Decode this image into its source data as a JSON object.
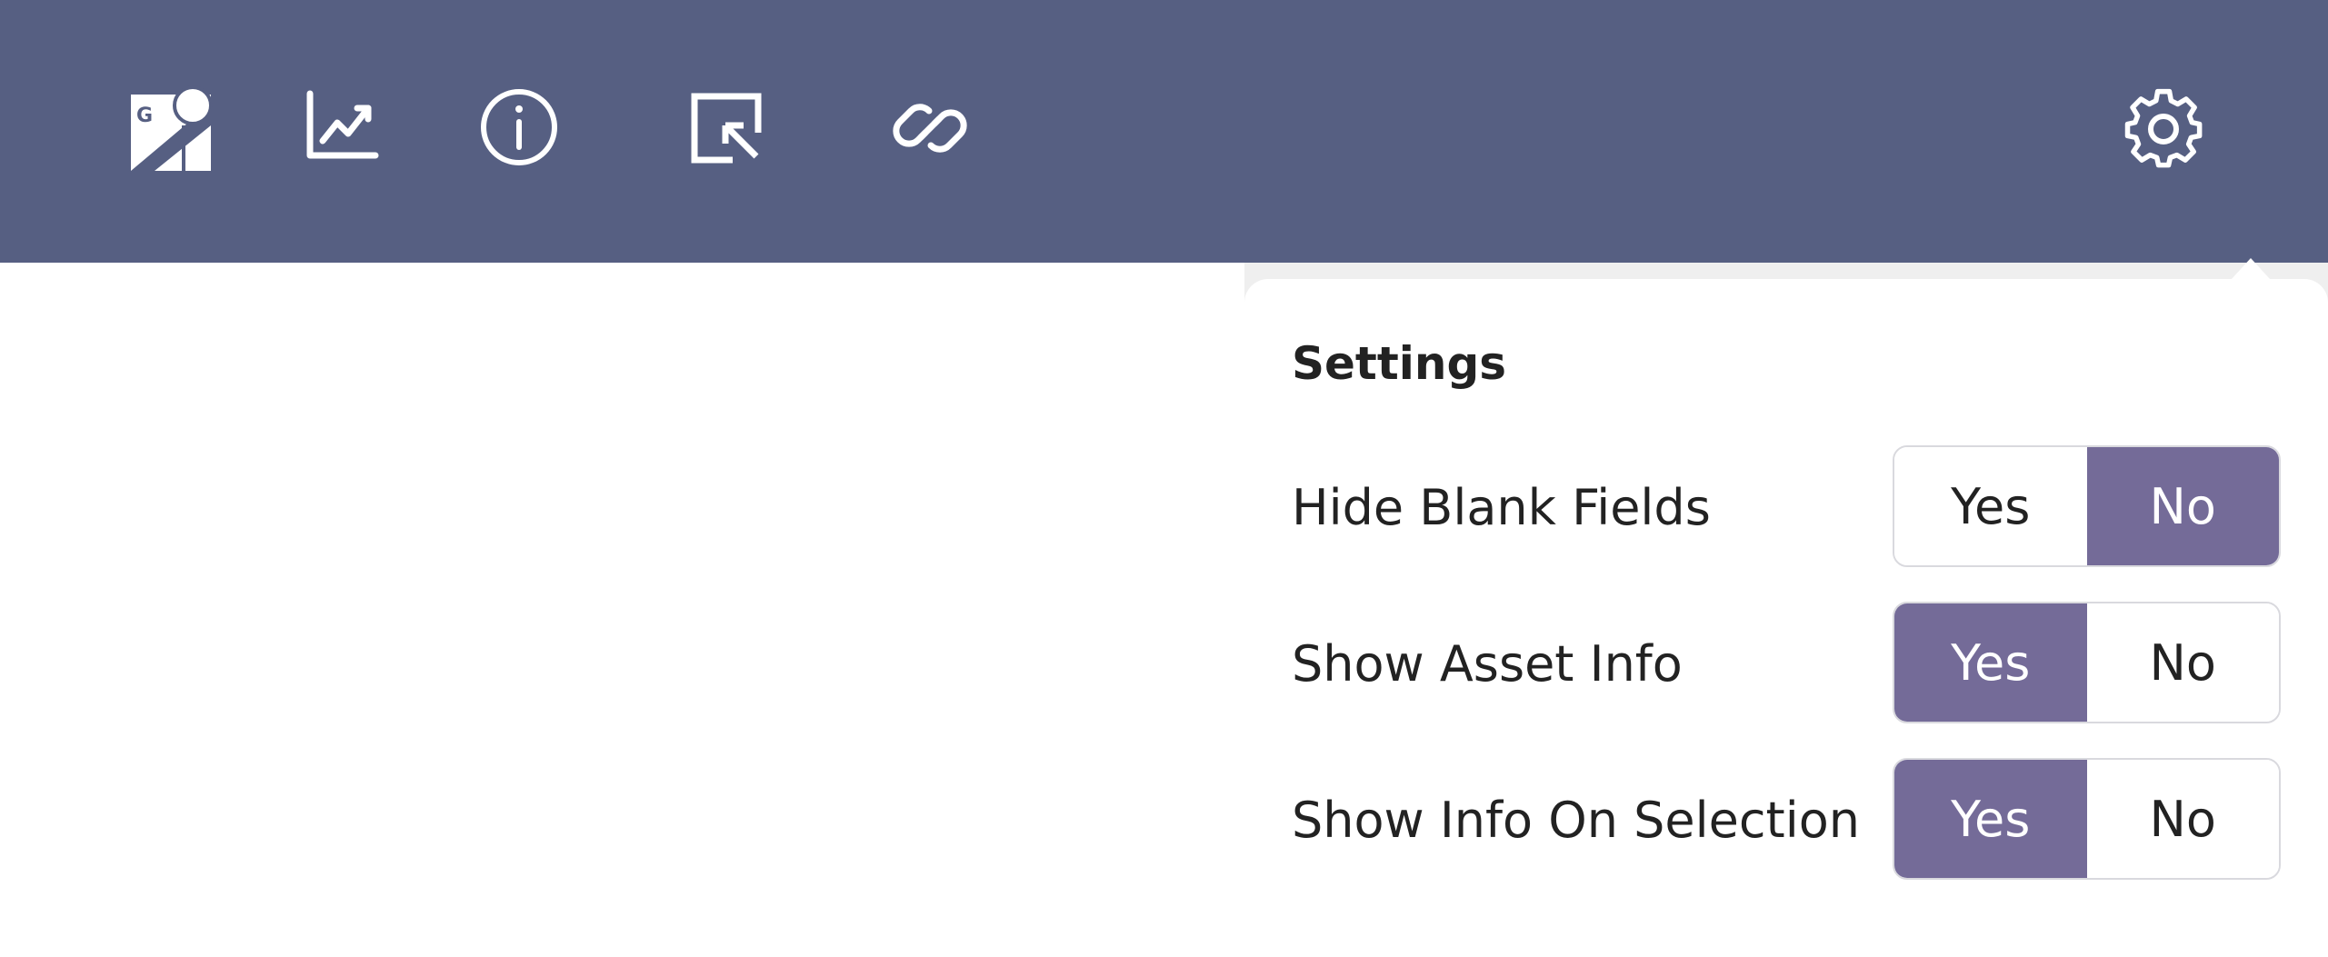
{
  "toolbar": {
    "background": "#565f82",
    "icons": [
      {
        "name": "g-chart-logo-icon",
        "letter": "G"
      },
      {
        "name": "line-chart-icon"
      },
      {
        "name": "info-icon"
      },
      {
        "name": "select-cursor-icon"
      },
      {
        "name": "link-icon"
      },
      {
        "name": "gear-icon"
      }
    ]
  },
  "settings": {
    "title": "Settings",
    "accent": "#746b98",
    "rows": [
      {
        "label": "Hide Blank Fields",
        "yes": "Yes",
        "no": "No",
        "selected": "No"
      },
      {
        "label": "Show Asset Info",
        "yes": "Yes",
        "no": "No",
        "selected": "Yes"
      },
      {
        "label": "Show Info On Selection",
        "yes": "Yes",
        "no": "No",
        "selected": "Yes"
      }
    ]
  }
}
